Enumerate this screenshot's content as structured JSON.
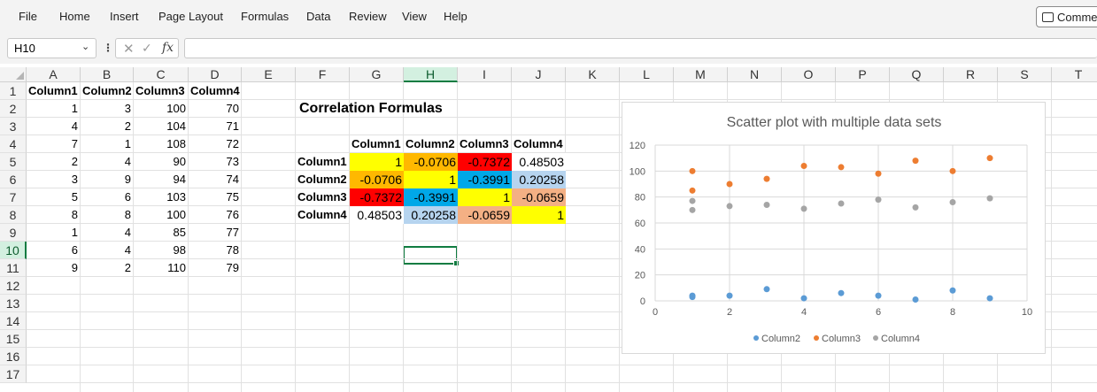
{
  "menu": {
    "items": [
      "File",
      "Home",
      "Insert",
      "Page Layout",
      "Formulas",
      "Data",
      "Review",
      "View",
      "Help"
    ],
    "comments_label": "Comme"
  },
  "formula_bar": {
    "name_box": "H10",
    "fx_label": "fx",
    "value": ""
  },
  "grid": {
    "columns": [
      "A",
      "B",
      "C",
      "D",
      "E",
      "F",
      "G",
      "H",
      "I",
      "J",
      "K",
      "L",
      "M",
      "N",
      "O",
      "P",
      "Q",
      "R",
      "S",
      "T"
    ],
    "rows": [
      "1",
      "2",
      "3",
      "4",
      "5",
      "6",
      "7",
      "8",
      "9",
      "10",
      "11",
      "12",
      "13",
      "14",
      "15",
      "16",
      "17"
    ],
    "selected_column": "H",
    "selected_row": "10"
  },
  "data_table": {
    "headers": [
      "Column1",
      "Column2",
      "Column3",
      "Column4"
    ],
    "rows": [
      [
        "1",
        "3",
        "100",
        "70"
      ],
      [
        "4",
        "2",
        "104",
        "71"
      ],
      [
        "7",
        "1",
        "108",
        "72"
      ],
      [
        "2",
        "4",
        "90",
        "73"
      ],
      [
        "3",
        "9",
        "94",
        "74"
      ],
      [
        "5",
        "6",
        "103",
        "75"
      ],
      [
        "8",
        "8",
        "100",
        "76"
      ],
      [
        "1",
        "4",
        "85",
        "77"
      ],
      [
        "6",
        "4",
        "98",
        "78"
      ],
      [
        "9",
        "2",
        "110",
        "79"
      ]
    ]
  },
  "correlation": {
    "title": "Correlation Formulas",
    "col_headers": [
      "Column1",
      "Column2",
      "Column3",
      "Column4"
    ],
    "row_headers": [
      "Column1",
      "Column2",
      "Column3",
      "Column4"
    ],
    "values": [
      [
        "1",
        "-0.0706",
        "-0.7372",
        "0.48503"
      ],
      [
        "-0.0706",
        "1",
        "-0.3991",
        "0.20258"
      ],
      [
        "-0.7372",
        "-0.3991",
        "1",
        "-0.0659"
      ],
      [
        "0.48503",
        "0.20258",
        "-0.0659",
        "1"
      ]
    ],
    "colors": [
      [
        "#ffff00",
        "#ffb800",
        "#ff0000",
        "#ffffff"
      ],
      [
        "#ffb800",
        "#ffff00",
        "#00a8e8",
        "#b6d4ef"
      ],
      [
        "#ff0000",
        "#00a8e8",
        "#ffff00",
        "#f4b084"
      ],
      [
        "#ffffff",
        "#b6d4ef",
        "#f4b084",
        "#ffff00"
      ]
    ]
  },
  "chart_data": {
    "type": "scatter",
    "title": "Scatter plot with multiple data sets",
    "xlabel": "",
    "ylabel": "",
    "xlim": [
      0,
      10
    ],
    "ylim": [
      0,
      120
    ],
    "x_ticks": [
      "0",
      "2",
      "4",
      "6",
      "8",
      "10"
    ],
    "y_ticks": [
      "0",
      "20",
      "40",
      "60",
      "80",
      "100",
      "120"
    ],
    "grid": "vertical and horizontal",
    "legend_position": "bottom",
    "x": [
      1,
      4,
      7,
      2,
      3,
      5,
      8,
      1,
      6,
      9
    ],
    "series": [
      {
        "name": "Column2",
        "color": "#5b9bd5",
        "values": [
          3,
          2,
          1,
          4,
          9,
          6,
          8,
          4,
          4,
          2
        ]
      },
      {
        "name": "Column3",
        "color": "#ed7d31",
        "values": [
          100,
          104,
          108,
          90,
          94,
          103,
          100,
          85,
          98,
          110
        ]
      },
      {
        "name": "Column4",
        "color": "#a5a5a5",
        "values": [
          70,
          71,
          72,
          73,
          74,
          75,
          76,
          77,
          78,
          79
        ]
      }
    ]
  }
}
